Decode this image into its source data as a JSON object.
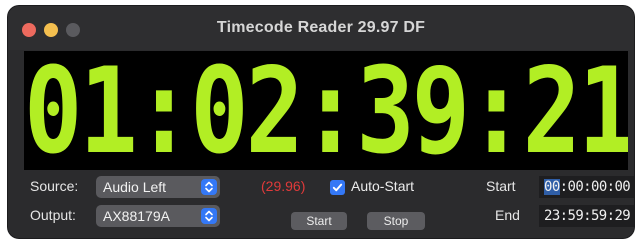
{
  "window": {
    "title": "Timecode Reader 29.97 DF"
  },
  "display": {
    "timecode": "01:02:39:21",
    "color": "#b2ee24"
  },
  "source": {
    "label": "Source:",
    "value": "Audio Left"
  },
  "output": {
    "label": "Output:",
    "value": "AX88179A"
  },
  "status": {
    "detected_rate": "(29.96)",
    "rate_color": "#e03a3a"
  },
  "auto_start": {
    "label": "Auto-Start",
    "checked": true
  },
  "buttons": {
    "start": "Start",
    "stop": "Stop"
  },
  "range": {
    "start_label": "Start",
    "start_selected": "00",
    "start_rest": ":00:00:00",
    "end_label": "End",
    "end_value": "23:59:59:29"
  },
  "icons": {
    "close": "close-icon",
    "minimize": "minimize-icon",
    "zoom": "zoom-icon",
    "popup": "chevron-updown-icon",
    "check": "checkmark-icon"
  },
  "colors": {
    "accent": "#3478f6",
    "background": "#2b2b2d"
  }
}
